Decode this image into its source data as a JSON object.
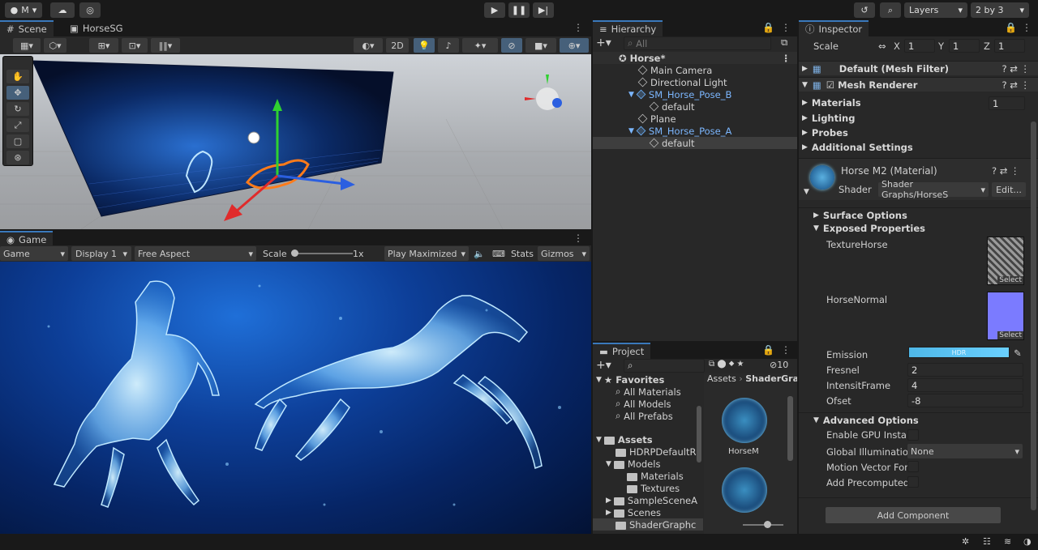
{
  "toolbar": {
    "account": "M",
    "layers": "Layers",
    "layout": "2 by 3"
  },
  "scene": {
    "tab_scene": "Scene",
    "tab_horsesg": "HorseSG",
    "mode_2d": "2D"
  },
  "game": {
    "tab": "Game",
    "view": "Game",
    "display": "Display 1",
    "aspect": "Free Aspect",
    "scale_label": "Scale",
    "scale_value": "1x",
    "play_mode": "Play Maximized",
    "stats": "Stats",
    "gizmos": "Gizmos"
  },
  "hierarchy": {
    "tab": "Hierarchy",
    "search_placeholder": "All",
    "scene_name": "Horse*",
    "items": [
      {
        "label": "Main Camera",
        "depth": 1,
        "prefab": false
      },
      {
        "label": "Directional Light",
        "depth": 1,
        "prefab": false
      },
      {
        "label": "SM_Horse_Pose_B",
        "depth": 1,
        "prefab": true
      },
      {
        "label": "default",
        "depth": 2,
        "prefab": false
      },
      {
        "label": "Plane",
        "depth": 1,
        "prefab": false
      },
      {
        "label": "SM_Horse_Pose_A",
        "depth": 1,
        "prefab": true
      },
      {
        "label": "default",
        "depth": 2,
        "prefab": false
      }
    ]
  },
  "project": {
    "tab": "Project",
    "hidden_count": "10",
    "breadcrumb_root": "Assets",
    "breadcrumb_current": "ShaderGra",
    "favorites_label": "Favorites",
    "favorites": [
      "All Materials",
      "All Models",
      "All Prefabs"
    ],
    "assets_label": "Assets",
    "folders": [
      {
        "label": "HDRPDefaultR",
        "depth": 1
      },
      {
        "label": "Models",
        "depth": 1
      },
      {
        "label": "Materials",
        "depth": 2
      },
      {
        "label": "Textures",
        "depth": 2
      },
      {
        "label": "SampleSceneA",
        "depth": 1
      },
      {
        "label": "Scenes",
        "depth": 1
      },
      {
        "label": "ShaderGraphc",
        "depth": 1
      }
    ],
    "asset_tile_label": "HorseM"
  },
  "inspector": {
    "tab": "Inspector",
    "scale_label": "Scale",
    "scale_x": "1",
    "scale_y": "1",
    "scale_z": "1",
    "mesh_filter": "Default (Mesh Filter)",
    "mesh_renderer": "Mesh Renderer",
    "sections": {
      "materials": "Materials",
      "materials_count": "1",
      "lighting": "Lighting",
      "probes": "Probes",
      "additional": "Additional Settings"
    },
    "material_name": "Horse M2 (Material)",
    "shader_label": "Shader",
    "shader_value": "Shader Graphs/HorseS",
    "edit_button": "Edit...",
    "surface_options": "Surface Options",
    "exposed_properties": "Exposed Properties",
    "texture_horse": "TextureHorse",
    "horse_normal": "HorseNormal",
    "select_label": "Select",
    "emission_label": "Emission",
    "emission_hdr": "HDR",
    "fresnel_label": "Fresnel",
    "fresnel_value": "2",
    "intensity_label": "IntensitFrame",
    "intensity_value": "4",
    "offset_label": "Ofset",
    "offset_value": "-8",
    "advanced_options": "Advanced Options",
    "gpu_instancing": "Enable GPU Instan",
    "global_illum": "Global Illumination",
    "global_illum_value": "None",
    "motion_vector": "Motion Vector For",
    "add_precomputed": "Add Precomputed",
    "add_component": "Add Component"
  }
}
